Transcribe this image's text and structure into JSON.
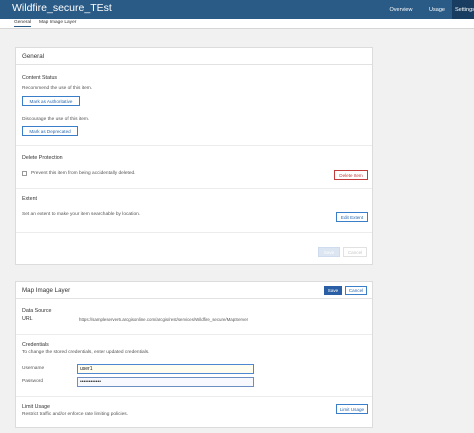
{
  "header": {
    "title": "Wildfire_secure_TEst",
    "nav": [
      {
        "label": "Overview"
      },
      {
        "label": "Usage"
      },
      {
        "label": "Settings"
      }
    ]
  },
  "subnav": {
    "tabs": [
      {
        "label": "General"
      },
      {
        "label": "Map Image Layer"
      }
    ]
  },
  "general": {
    "title": "General",
    "content_status": {
      "label": "Content Status",
      "recommend_text": "Recommend the use of this item.",
      "authoritative_button": "Mark as Authoritative",
      "discourage_text": "Discourage the use of this item.",
      "deprecated_button": "Mark as Deprecated"
    },
    "delete_protection": {
      "label": "Delete Protection",
      "checkbox_label": "Prevent this item from being accidentally deleted.",
      "delete_button": "Delete Item"
    },
    "extent": {
      "label": "Extent",
      "description": "Set an extent to make your item searchable by location.",
      "edit_button": "Edit Extent"
    },
    "save_button": "Save",
    "cancel_button": "Cancel"
  },
  "map_image_layer": {
    "title": "Map Image Layer",
    "save_button": "Save",
    "cancel_button": "Cancel",
    "data_source": {
      "label": "Data Source",
      "url_label": "URL",
      "url_value": "https://sampleserver6.arcgisonline.com/arcgis/rest/services/Wildfire_secure/MapServer"
    },
    "credentials": {
      "label": "Credentials",
      "hint": "To change the stored credentials, enter updated credentials.",
      "username_label": "Username",
      "username_value": "user1",
      "password_label": "Password",
      "password_value": "••••••••••••"
    },
    "limit_usage": {
      "label": "Limit Usage",
      "description": "Restrict traffic and/or enforce rate limiting policies.",
      "button": "Limit Usage"
    }
  }
}
